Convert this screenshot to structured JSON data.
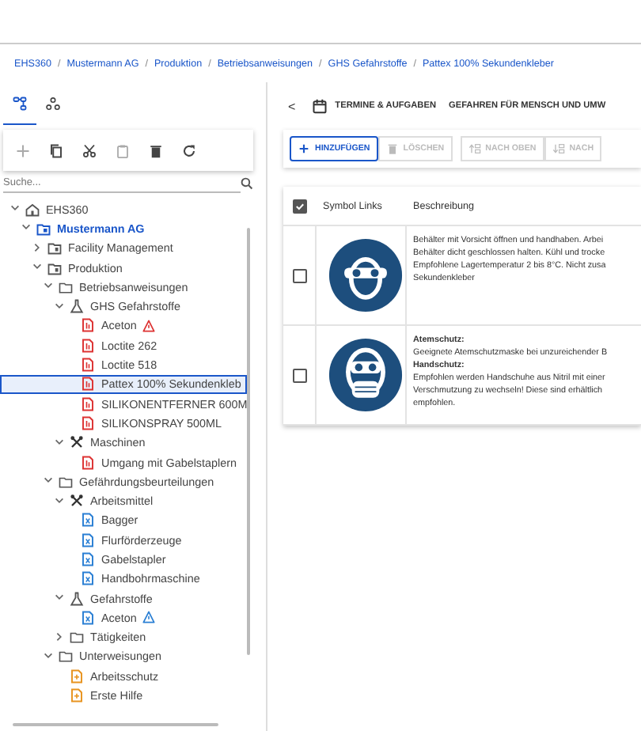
{
  "breadcrumb": {
    "separator": "/",
    "items": [
      "EHS360",
      "Mustermann AG",
      "Produktion",
      "Betriebsanweisungen",
      "GHS Gefahrstoffe",
      "Pattex 100% Sekundenkleber"
    ]
  },
  "left_tabs": [
    {
      "selected": true
    },
    {
      "selected": false
    }
  ],
  "tree_tools": [
    {
      "kind": "add",
      "disabled": true
    },
    {
      "kind": "copy",
      "disabled": false
    },
    {
      "kind": "cut",
      "disabled": false
    },
    {
      "kind": "paste",
      "disabled": true
    },
    {
      "kind": "delete",
      "disabled": false
    },
    {
      "kind": "refresh",
      "disabled": false
    }
  ],
  "search": {
    "placeholder": "Suche..."
  },
  "tree": [
    {
      "label": "EHS360",
      "kind": "home",
      "expanded": true,
      "selected": false,
      "children": [
        {
          "label": "Mustermann AG",
          "kind": "company",
          "expanded": true,
          "selected": false,
          "children": [
            {
              "label": "Facility Management",
              "kind": "site",
              "expanded": false,
              "selected": false
            },
            {
              "label": "Produktion",
              "kind": "site",
              "expanded": true,
              "selected": false,
              "children": [
                {
                  "label": "Betriebsanweisungen",
                  "kind": "folder",
                  "expanded": true,
                  "selected": false,
                  "children": [
                    {
                      "label": "GHS Gefahrstoffe",
                      "kind": "flask",
                      "expanded": true,
                      "selected": false,
                      "children": [
                        {
                          "label": "Aceton",
                          "kind": "doc-red",
                          "warning": true,
                          "selected": false
                        },
                        {
                          "label": "Loctite 262",
                          "kind": "doc-red",
                          "warning": false,
                          "selected": false
                        },
                        {
                          "label": "Loctite 518",
                          "kind": "doc-red",
                          "warning": false,
                          "selected": false
                        },
                        {
                          "label": "Pattex 100% Sekundenkleb",
                          "kind": "doc-red",
                          "warning": false,
                          "selected": true
                        },
                        {
                          "label": "SILIKONENTFERNER 600M",
                          "kind": "doc-red",
                          "warning": false,
                          "selected": false
                        },
                        {
                          "label": "SILIKONSPRAY 500ML",
                          "kind": "doc-red",
                          "warning": false,
                          "selected": false
                        }
                      ]
                    },
                    {
                      "label": "Maschinen",
                      "kind": "tools",
                      "expanded": true,
                      "selected": false,
                      "children": [
                        {
                          "label": "Umgang mit Gabelstaplern",
                          "kind": "doc-red",
                          "selected": false
                        }
                      ]
                    }
                  ]
                },
                {
                  "label": "Gefährdungsbeurteilungen",
                  "kind": "folder",
                  "expanded": true,
                  "selected": false,
                  "children": [
                    {
                      "label": "Arbeitsmittel",
                      "kind": "tools",
                      "expanded": true,
                      "selected": false,
                      "children": [
                        {
                          "label": "Bagger",
                          "kind": "doc-blue",
                          "selected": false
                        },
                        {
                          "label": "Flurförderzeuge",
                          "kind": "doc-blue",
                          "selected": false
                        },
                        {
                          "label": "Gabelstapler",
                          "kind": "doc-blue",
                          "selected": false
                        },
                        {
                          "label": "Handbohrmaschine",
                          "kind": "doc-blue",
                          "selected": false
                        }
                      ]
                    },
                    {
                      "label": "Gefahrstoffe",
                      "kind": "flask",
                      "expanded": true,
                      "selected": false,
                      "children": [
                        {
                          "label": "Aceton",
                          "kind": "doc-blue",
                          "warning": true,
                          "selected": false
                        }
                      ]
                    },
                    {
                      "label": "Tätigkeiten",
                      "kind": "folder",
                      "expanded": false,
                      "selected": false
                    }
                  ]
                },
                {
                  "label": "Unterweisungen",
                  "kind": "folder",
                  "expanded": true,
                  "selected": false,
                  "children": [
                    {
                      "label": "Arbeitsschutz",
                      "kind": "doc-orange",
                      "selected": false
                    },
                    {
                      "label": "Erste Hilfe",
                      "kind": "doc-orange",
                      "selected": false
                    }
                  ]
                }
              ]
            }
          ]
        }
      ]
    }
  ],
  "detail_tabs": [
    {
      "kind": "back",
      "label": "<"
    },
    {
      "kind": "calendar",
      "label": "TERMINE & AUFGABEN"
    },
    {
      "kind": "plain",
      "label": "GEFAHREN FÜR MENSCH UND UMW"
    }
  ],
  "actions": [
    {
      "kind": "add",
      "label": "HINZUFÜGEN",
      "disabled": false
    },
    {
      "kind": "delete",
      "label": "LÖSCHEN",
      "disabled": true
    },
    {
      "kind": "up",
      "label": "NACH OBEN",
      "disabled": true
    },
    {
      "kind": "down",
      "label": "NACH",
      "disabled": true
    }
  ],
  "table": {
    "all_checked": true,
    "columns": [
      "Symbol Links",
      "Beschreibung"
    ],
    "rows": [
      {
        "checked": false,
        "lines": [
          {
            "kind": "text",
            "text": "Behälter mit Vorsicht öffnen und handhaben. Arbei"
          },
          {
            "kind": "text",
            "text": "Behälter dicht geschlossen halten. Kühl und trocke"
          },
          {
            "kind": "text",
            "text": "Empfohlene Lagertemperatur 2 bis 8°C. Nicht zusa"
          },
          {
            "kind": "text",
            "text": "Sekundenkleber"
          }
        ]
      },
      {
        "checked": false,
        "lines": [
          {
            "kind": "heading",
            "text": "Atemschutz:"
          },
          {
            "kind": "text",
            "text": "Geeignete Atemschutzmaske bei unzureichender B"
          },
          {
            "kind": "heading",
            "text": "Handschutz:"
          },
          {
            "kind": "text",
            "text": "Empfohlen werden Handschuhe aus Nitril mit einer"
          },
          {
            "kind": "text",
            "text": "Verschmutzung zu wechseln! Diese sind erhältlich"
          },
          {
            "kind": "text",
            "text": "empfohlen."
          }
        ]
      }
    ]
  }
}
